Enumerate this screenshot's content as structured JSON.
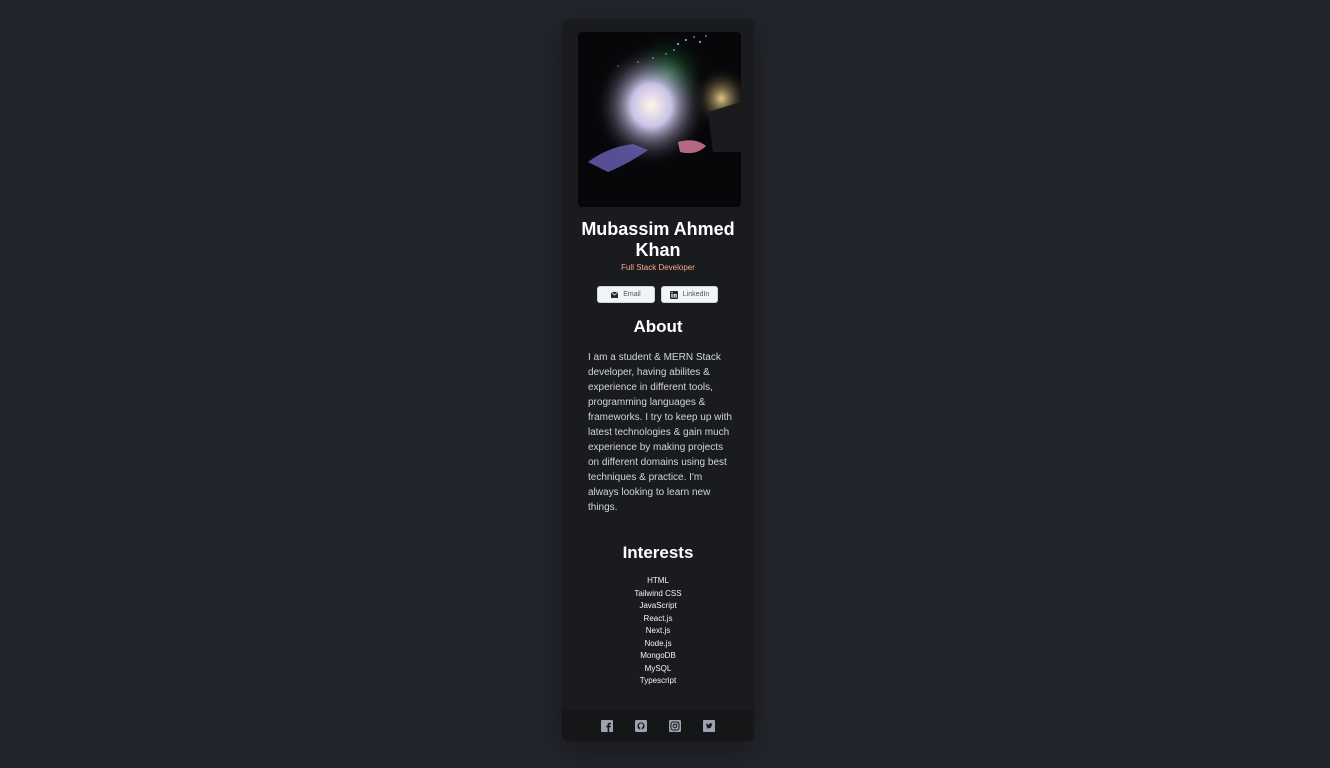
{
  "profile": {
    "name": "Mubassim Ahmed Khan",
    "role": "Full Stack Developer"
  },
  "buttons": {
    "email": "Email",
    "linkedin": "LinkedIn"
  },
  "about": {
    "heading": "About",
    "text": "I am a student & MERN Stack developer, having abilites & experience in different tools, programming languages & frameworks. I try to keep up with latest technologies & gain much experience by making projects on different domains using best techniques & practice. I'm always looking to learn new things."
  },
  "interests": {
    "heading": "Interests",
    "items": [
      "HTML",
      "Tailwind CSS",
      "JavaScript",
      "React.js",
      "Next.js",
      "Node.js",
      "MongoDB",
      "MySQL",
      "Typescript"
    ]
  },
  "footer": {
    "icons": [
      "facebook-icon",
      "github-icon",
      "instagram-icon",
      "twitter-icon"
    ]
  },
  "colors": {
    "page_bg": "#23252c",
    "card_bg": "#1a1b1f",
    "footer_bg": "#151618",
    "accent": "#f7a98a",
    "icon": "#9ca3af"
  }
}
